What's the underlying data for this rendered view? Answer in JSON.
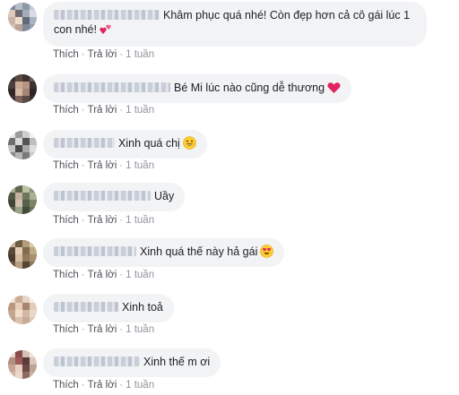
{
  "comments": [
    {
      "text_line1": "Khâm phục quá nhé! Còn đẹp hơn cả cô gái lúc 1",
      "text_line2": "con nhé!",
      "emoji": "two-hearts",
      "actions": {
        "like": "Thích",
        "reply": "Trả lời",
        "time": "1 tuần"
      }
    },
    {
      "text": "Bé Mi lúc nào cũng dễ thương",
      "emoji": "red-heart",
      "actions": {
        "like": "Thích",
        "reply": "Trả lời",
        "time": "1 tuần"
      }
    },
    {
      "text": "Xinh quá chị",
      "emoji": "grinning-face",
      "actions": {
        "like": "Thích",
        "reply": "Trả lời",
        "time": "1 tuần"
      }
    },
    {
      "text": "Uầy",
      "actions": {
        "like": "Thích",
        "reply": "Trả lời",
        "time": "1 tuần"
      }
    },
    {
      "text": "Xinh quá thế này hả gái",
      "emoji": "heart-eyes-face",
      "actions": {
        "like": "Thích",
        "reply": "Trả lời",
        "time": "1 tuần"
      }
    },
    {
      "text": "Xinh toả",
      "actions": {
        "like": "Thích",
        "reply": "Trả lời",
        "time": "1 tuần"
      }
    },
    {
      "text": "Xinh thế m ơi",
      "actions": {
        "like": "Thích",
        "reply": "Trả lời",
        "time": "1 tuần"
      }
    }
  ],
  "separator": "·"
}
